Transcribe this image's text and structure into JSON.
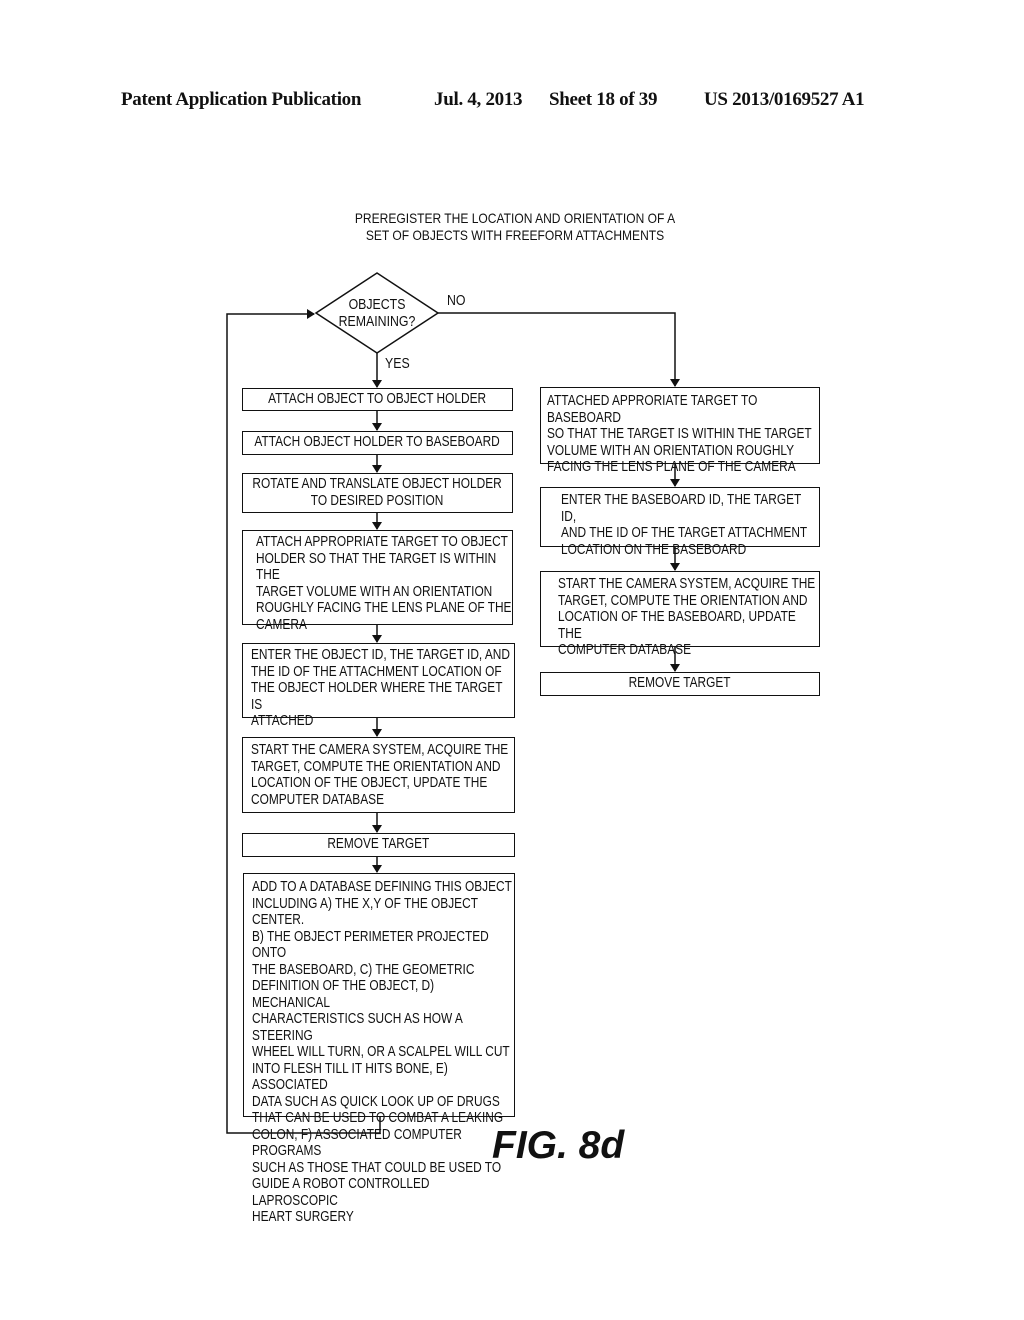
{
  "header": {
    "publication": "Patent Application Publication",
    "date": "Jul. 4, 2013",
    "sheet": "Sheet 18 of 39",
    "number": "US 2013/0169527 A1"
  },
  "flowchart": {
    "title": "PREREGISTER THE LOCATION AND ORIENTATION OF A\nSET OF OBJECTS WITH FREEFORM ATTACHMENTS",
    "decision": {
      "text": "OBJECTS\nREMAINING?",
      "yes_label": "YES",
      "no_label": "NO"
    },
    "yes_branch": [
      "ATTACH OBJECT TO OBJECT HOLDER",
      "ATTACH OBJECT HOLDER TO BASEBOARD",
      "ROTATE AND TRANSLATE OBJECT HOLDER\nTO DESIRED POSITION",
      "ATTACH APPROPRIATE TARGET TO OBJECT\nHOLDER SO THAT THE TARGET IS WITHIN THE\nTARGET VOLUME WITH AN ORIENTATION\nROUGHLY FACING THE LENS PLANE OF THE\nCAMERA",
      "ENTER THE OBJECT ID, THE TARGET ID, AND\nTHE ID OF THE ATTACHMENT LOCATION OF\nTHE OBJECT HOLDER WHERE THE TARGET IS\nATTACHED",
      "START THE CAMERA SYSTEM, ACQUIRE THE\nTARGET, COMPUTE THE ORIENTATION AND\nLOCATION OF THE OBJECT, UPDATE THE\nCOMPUTER DATABASE",
      "REMOVE TARGET",
      "ADD TO A DATABASE DEFINING THIS OBJECT\nINCLUDING A) THE X,Y OF THE OBJECT CENTER.\nB)  THE OBJECT PERIMETER PROJECTED ONTO\nTHE BASEBOARD, C) THE GEOMETRIC\nDEFINITION OF THE OBJECT, D) MECHANICAL\nCHARACTERISTICS SUCH AS HOW A STEERING\nWHEEL WILL TURN, OR A SCALPEL WILL CUT\nINTO FLESH TILL IT HITS BONE, E) ASSOCIATED\nDATA SUCH AS QUICK LOOK UP OF DRUGS\nTHAT CAN BE USED TO COMBAT A LEAKING\nCOLON, F) ASSOCIATED COMPUTER PROGRAMS\nSUCH AS THOSE THAT COULD BE USED TO\nGUIDE A ROBOT CONTROLLED LAPROSCOPIC\nHEART SURGERY"
    ],
    "no_branch": [
      "ATTACHED APPRORIATE TARGET TO BASEBOARD\nSO THAT THE TARGET IS WITHIN THE TARGET\nVOLUME WITH AN ORIENTATION ROUGHLY\nFACING THE LENS PLANE OF THE CAMERA",
      "ENTER THE BASEBOARD ID, THE TARGET ID,\nAND THE ID OF THE TARGET ATTACHMENT\nLOCATION ON THE BASEBOARD",
      "START THE CAMERA SYSTEM, ACQUIRE THE\nTARGET, COMPUTE THE ORIENTATION AND\nLOCATION OF THE BASEBOARD, UPDATE THE\nCOMPUTER DATABASE",
      "REMOVE TARGET"
    ]
  },
  "figure_label": "FIG. 8d"
}
